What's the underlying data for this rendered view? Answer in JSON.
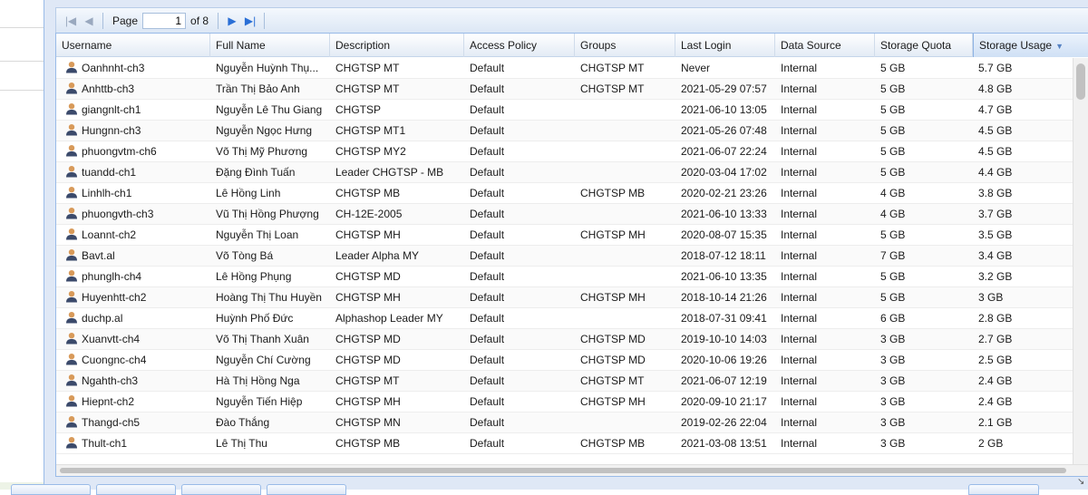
{
  "pagination": {
    "page_label": "Page",
    "current_page": "1",
    "of_label": "of 8"
  },
  "columns": [
    {
      "label": "Username"
    },
    {
      "label": "Full Name"
    },
    {
      "label": "Description"
    },
    {
      "label": "Access Policy"
    },
    {
      "label": "Groups"
    },
    {
      "label": "Last Login"
    },
    {
      "label": "Data Source"
    },
    {
      "label": "Storage Quota"
    },
    {
      "label": "Storage Usage",
      "sorted": "desc"
    }
  ],
  "rows": [
    {
      "username": "Oanhnht-ch3",
      "fullname": "Nguyễn Huỳnh Thụ...",
      "description": "CHGTSP MT",
      "policy": "Default",
      "groups": "CHGTSP MT",
      "last_login": "Never",
      "source": "Internal",
      "quota": "5 GB",
      "usage": "5.7 GB"
    },
    {
      "username": "Anhttb-ch3",
      "fullname": "Trần Thị Bảo Anh",
      "description": "CHGTSP MT",
      "policy": "Default",
      "groups": "CHGTSP MT",
      "last_login": "2021-05-29 07:57",
      "source": "Internal",
      "quota": "5 GB",
      "usage": "4.8 GB"
    },
    {
      "username": "giangnlt-ch1",
      "fullname": "Nguyễn Lê Thu Giang",
      "description": "CHGTSP",
      "policy": "Default",
      "groups": "",
      "last_login": "2021-06-10 13:05",
      "source": "Internal",
      "quota": "5 GB",
      "usage": "4.7 GB"
    },
    {
      "username": "Hungnn-ch3",
      "fullname": "Nguyễn Ngọc Hưng",
      "description": "CHGTSP MT1",
      "policy": "Default",
      "groups": "",
      "last_login": "2021-05-26 07:48",
      "source": "Internal",
      "quota": "5 GB",
      "usage": "4.5 GB"
    },
    {
      "username": "phuongvtm-ch6",
      "fullname": "Võ Thị Mỹ Phương",
      "description": "CHGTSP MY2",
      "policy": "Default",
      "groups": "",
      "last_login": "2021-06-07 22:24",
      "source": "Internal",
      "quota": "5 GB",
      "usage": "4.5 GB"
    },
    {
      "username": "tuandd-ch1",
      "fullname": "Đặng Đình Tuấn",
      "description": "Leader CHGTSP - MB",
      "policy": "Default",
      "groups": "",
      "last_login": "2020-03-04 17:02",
      "source": "Internal",
      "quota": "5 GB",
      "usage": "4.4 GB"
    },
    {
      "username": "Linhlh-ch1",
      "fullname": "Lê Hồng Linh",
      "description": "CHGTSP MB",
      "policy": "Default",
      "groups": "CHGTSP MB",
      "last_login": "2020-02-21 23:26",
      "source": "Internal",
      "quota": "4 GB",
      "usage": "3.8 GB"
    },
    {
      "username": "phuongvth-ch3",
      "fullname": "Vũ Thị Hồng Phượng",
      "description": "CH-12E-2005",
      "policy": "Default",
      "groups": "",
      "last_login": "2021-06-10 13:33",
      "source": "Internal",
      "quota": "4 GB",
      "usage": "3.7 GB"
    },
    {
      "username": "Loannt-ch2",
      "fullname": "Nguyễn Thị Loan",
      "description": "CHGTSP MH",
      "policy": "Default",
      "groups": "CHGTSP MH",
      "last_login": "2020-08-07 15:35",
      "source": "Internal",
      "quota": "5 GB",
      "usage": "3.5 GB"
    },
    {
      "username": "Bavt.al",
      "fullname": "Võ Tòng Bá",
      "description": "Leader Alpha MY",
      "policy": "Default",
      "groups": "",
      "last_login": "2018-07-12 18:11",
      "source": "Internal",
      "quota": "7 GB",
      "usage": "3.4 GB"
    },
    {
      "username": "phunglh-ch4",
      "fullname": "Lê Hồng Phụng",
      "description": "CHGTSP MD",
      "policy": "Default",
      "groups": "",
      "last_login": "2021-06-10 13:35",
      "source": "Internal",
      "quota": "5 GB",
      "usage": "3.2 GB"
    },
    {
      "username": "Huyenhtt-ch2",
      "fullname": "Hoàng Thị Thu Huyền",
      "description": "CHGTSP MH",
      "policy": "Default",
      "groups": "CHGTSP MH",
      "last_login": "2018-10-14 21:26",
      "source": "Internal",
      "quota": "5 GB",
      "usage": "3 GB"
    },
    {
      "username": "duchp.al",
      "fullname": "Huỳnh Phố Đức",
      "description": "Alphashop Leader MY",
      "policy": "Default",
      "groups": "",
      "last_login": "2018-07-31 09:41",
      "source": "Internal",
      "quota": "6 GB",
      "usage": "2.8 GB"
    },
    {
      "username": "Xuanvtt-ch4",
      "fullname": "Võ Thị Thanh Xuân",
      "description": "CHGTSP MD",
      "policy": "Default",
      "groups": "CHGTSP MD",
      "last_login": "2019-10-10 14:03",
      "source": "Internal",
      "quota": "3 GB",
      "usage": "2.7 GB"
    },
    {
      "username": "Cuongnc-ch4",
      "fullname": "Nguyễn Chí Cường",
      "description": "CHGTSP MD",
      "policy": "Default",
      "groups": "CHGTSP MD",
      "last_login": "2020-10-06 19:26",
      "source": "Internal",
      "quota": "3 GB",
      "usage": "2.5 GB"
    },
    {
      "username": "Ngahth-ch3",
      "fullname": "Hà Thị Hồng Nga",
      "description": "CHGTSP MT",
      "policy": "Default",
      "groups": "CHGTSP MT",
      "last_login": "2021-06-07 12:19",
      "source": "Internal",
      "quota": "3 GB",
      "usage": "2.4 GB"
    },
    {
      "username": "Hiepnt-ch2",
      "fullname": "Nguyễn Tiến Hiệp",
      "description": "CHGTSP MH",
      "policy": "Default",
      "groups": "CHGTSP MH",
      "last_login": "2020-09-10 21:17",
      "source": "Internal",
      "quota": "3 GB",
      "usage": "2.4 GB"
    },
    {
      "username": "Thangd-ch5",
      "fullname": "Đào Thắng",
      "description": "CHGTSP MN",
      "policy": "Default",
      "groups": "",
      "last_login": "2019-02-26 22:04",
      "source": "Internal",
      "quota": "3 GB",
      "usage": "2.1 GB"
    },
    {
      "username": "Thult-ch1",
      "fullname": "Lê Thị Thu",
      "description": "CHGTSP MB",
      "policy": "Default",
      "groups": "CHGTSP MB",
      "last_login": "2021-03-08 13:51",
      "source": "Internal",
      "quota": "3 GB",
      "usage": "2 GB"
    }
  ],
  "colors": {
    "panel_bg": "#dfe8f6",
    "border": "#99bbe8",
    "icon_head": "#d89a5a",
    "icon_body": "#3b4a6b"
  },
  "icons": {
    "first": "first-page-icon",
    "prev": "prev-page-icon",
    "next": "next-page-icon",
    "last": "last-page-icon",
    "user": "user-icon"
  }
}
